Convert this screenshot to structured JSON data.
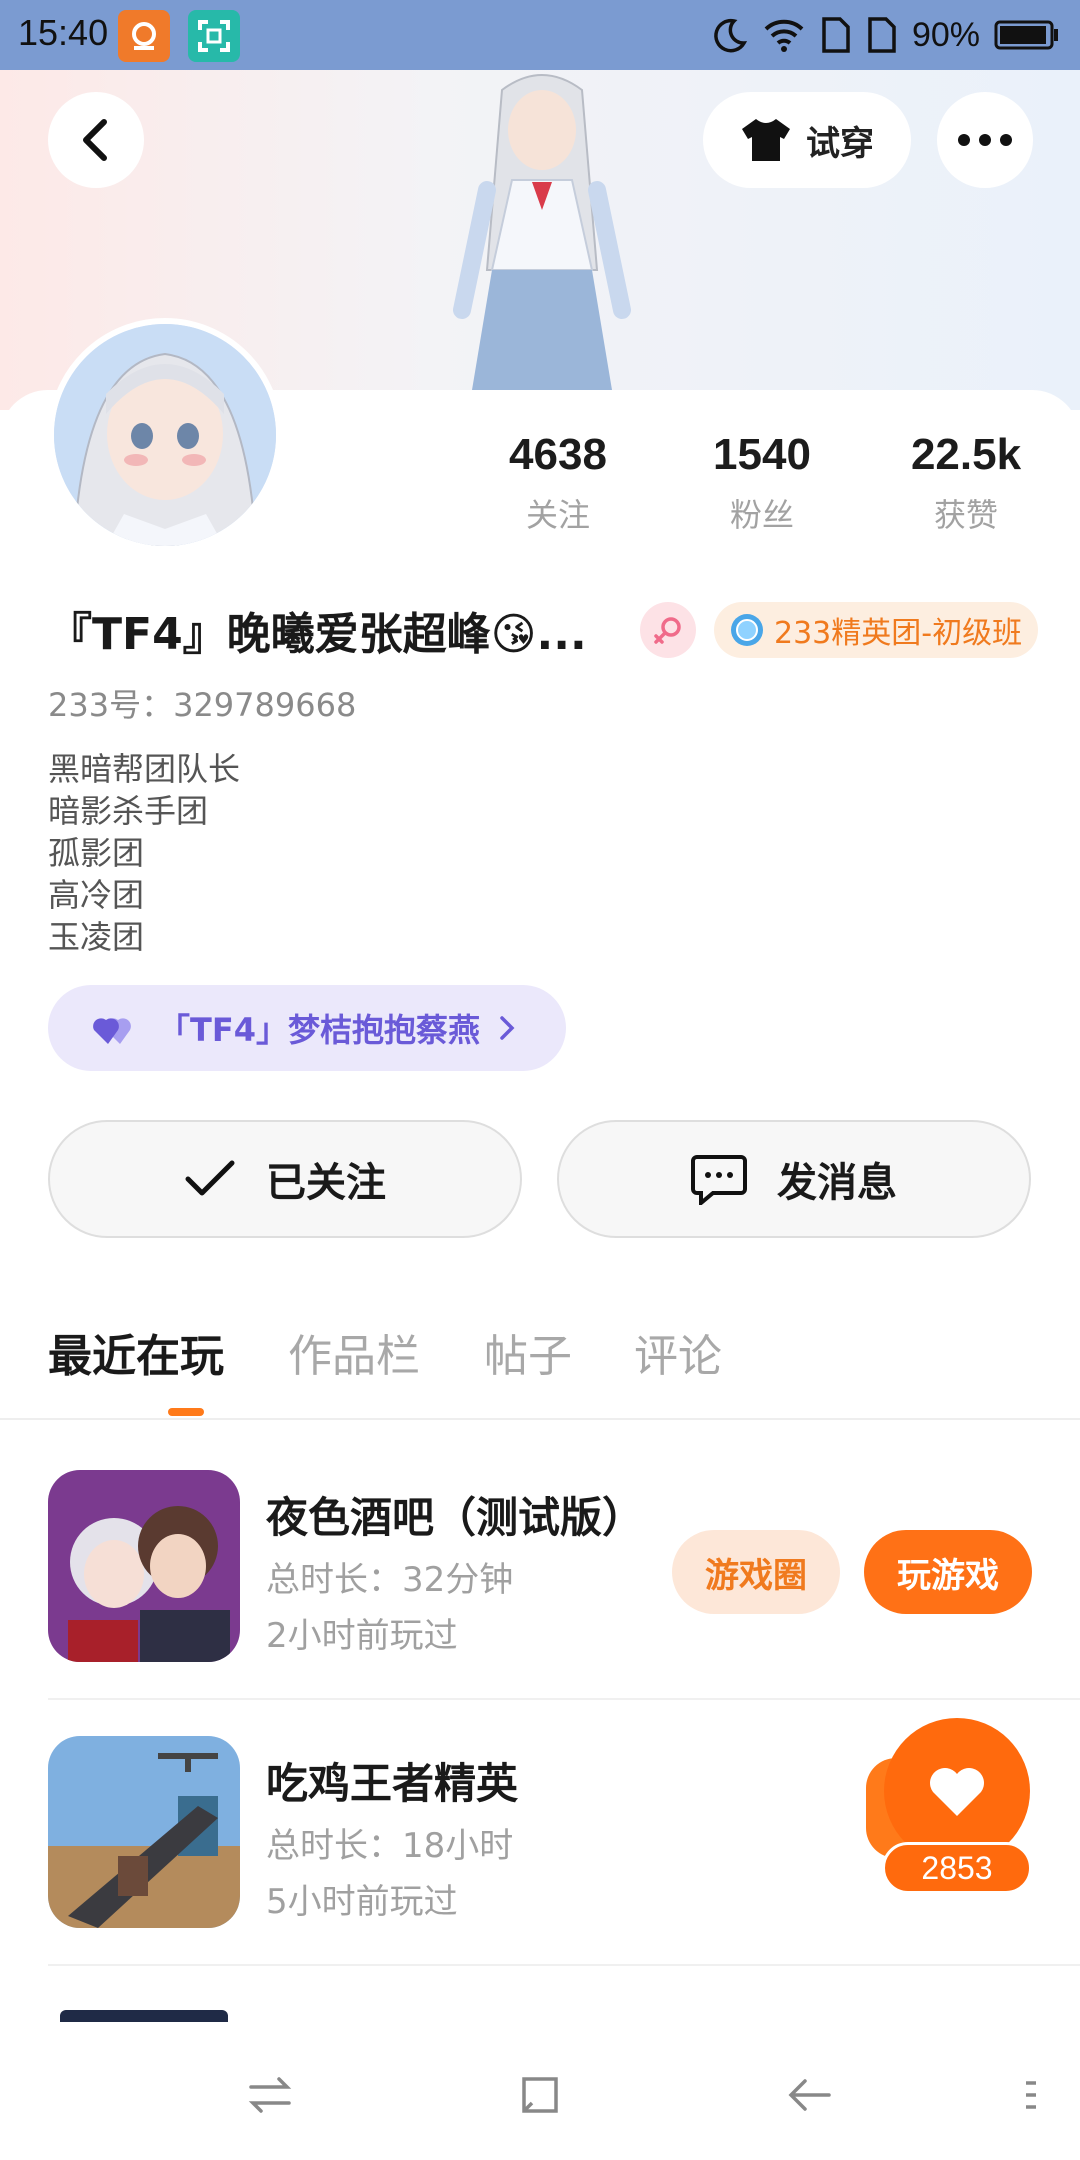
{
  "status_bar": {
    "time": "15:40",
    "battery_text": "90%",
    "icons": [
      "moon-icon",
      "wifi-icon",
      "sim1-icon",
      "sim2-icon",
      "battery-icon"
    ]
  },
  "header": {
    "tryon_label": "试穿"
  },
  "profile": {
    "stats": [
      {
        "value": "4638",
        "label": "关注"
      },
      {
        "value": "1540",
        "label": "粉丝"
      },
      {
        "value": "22.5k",
        "label": "获赞"
      }
    ],
    "name": "『TF4』晚曦爱张超峰😘...",
    "guild_badge": "233精英团-初级班",
    "uid": "233号：329789668",
    "bio": [
      "黑暗帮团队长",
      "暗影杀手团",
      "孤影团",
      "高冷团",
      "玉凌团"
    ],
    "relation": "「TF4」梦桔抱抱蔡燕",
    "follow_label": "已关注",
    "message_label": "发消息"
  },
  "tabs": [
    {
      "label": "最近在玩"
    },
    {
      "label": "作品栏"
    },
    {
      "label": "帖子"
    },
    {
      "label": "评论"
    }
  ],
  "games": [
    {
      "title": "夜色酒吧（测试版）",
      "duration": "总时长：32分钟",
      "last_played": "2小时前玩过",
      "circle_label": "游戏圈",
      "play_label": "玩游戏"
    },
    {
      "title": "吃鸡王者精英",
      "duration": "总时长：18小时",
      "last_played": "5小时前玩过"
    }
  ],
  "like_fab": {
    "count": "2853"
  },
  "colors": {
    "accent": "#ff7116",
    "status_bar": "#7b9bd1",
    "relation_text": "#6a5ad8"
  }
}
